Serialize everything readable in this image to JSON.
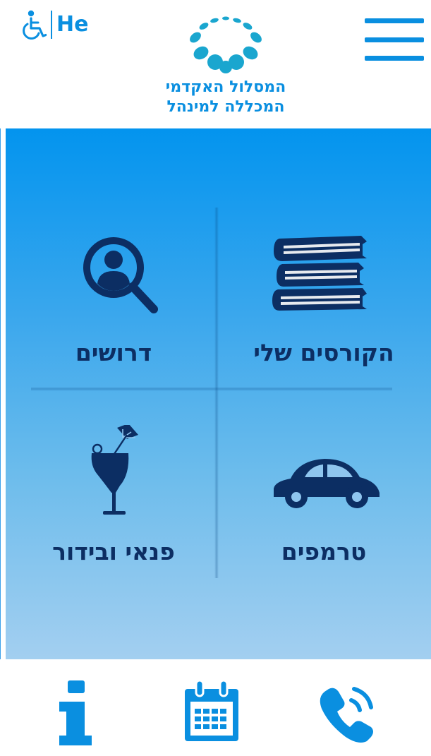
{
  "header": {
    "language_label": "He",
    "accessibility_icon": "wheelchair-icon",
    "menu_icon": "hamburger-menu-icon",
    "logo": {
      "line1": "המסלול האקדמי",
      "line2": "המכללה למינהל"
    }
  },
  "tiles": [
    {
      "label": "הקורסים שלי",
      "icon": "books-icon"
    },
    {
      "label": "דרושים",
      "icon": "search-person-icon"
    },
    {
      "label": "טרמפים",
      "icon": "car-icon"
    },
    {
      "label": "פנאי ובידור",
      "icon": "cocktail-icon"
    }
  ],
  "footer": {
    "icons": [
      "phone-icon",
      "calendar-icon",
      "info-icon"
    ]
  },
  "colors": {
    "accent": "#0a8fe0",
    "icon_dark": "#0c2e63",
    "logo_teal": "#1aa6cf"
  }
}
